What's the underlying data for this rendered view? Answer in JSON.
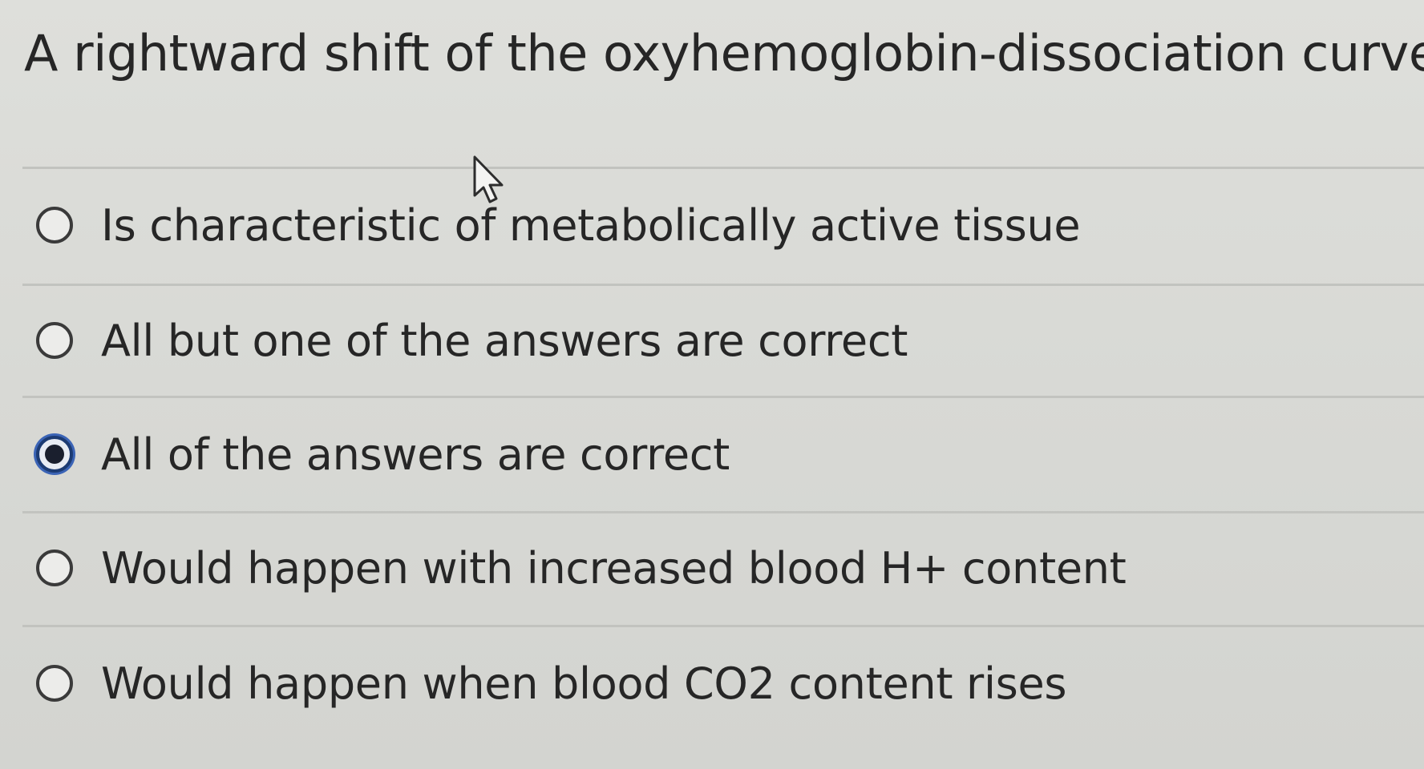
{
  "question": {
    "text": "A rightward shift of the oxyhemoglobin-dissociation curve..."
  },
  "options": [
    {
      "label": "Is characteristic of metabolically active tissue",
      "selected": false
    },
    {
      "label": "All but one of the answers are correct",
      "selected": false
    },
    {
      "label": "All of the answers are correct",
      "selected": true
    },
    {
      "label": "Would happen with increased blood H+ content",
      "selected": false
    },
    {
      "label": "Would happen when blood CO2 content rises",
      "selected": false
    }
  ],
  "colors": {
    "background": "#dcdcd8",
    "text": "#262626",
    "selected_radio_ring": "#3b64b6",
    "selected_radio_dot": "#1a1f2e",
    "divider": "#c2c3bf"
  },
  "icons": {
    "cursor": "mouse-pointer-arrow-icon"
  }
}
